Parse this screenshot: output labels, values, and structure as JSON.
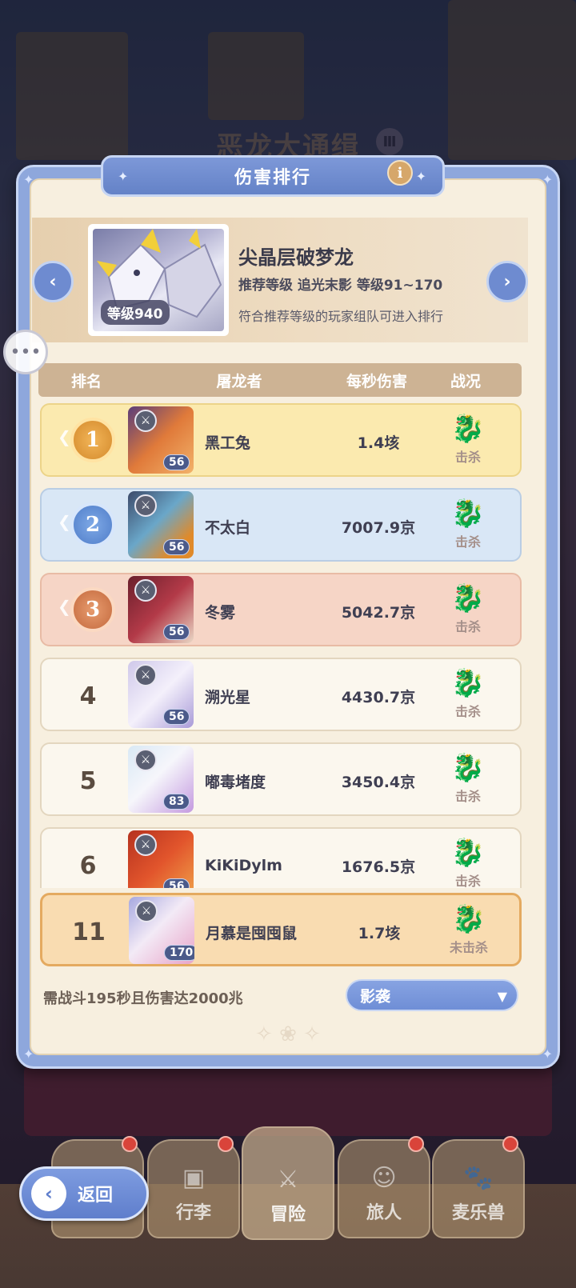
{
  "background": {
    "event_title": "恶龙大通缉",
    "event_badge": "Ⅲ"
  },
  "panel": {
    "title": "伤害排行",
    "info_icon": "i"
  },
  "boss": {
    "name": "尖晶层破梦龙",
    "level_label": "等级940",
    "recommend": "推荐等级 追光末影 等级91~170",
    "hint": "符合推荐等级的玩家组队可进入排行",
    "prev_icon": "chevron-left-icon",
    "next_icon": "chevron-right-icon"
  },
  "table": {
    "headers": {
      "rank": "排名",
      "player": "屠龙者",
      "dps": "每秒伤害",
      "status": "战况"
    },
    "rows": [
      {
        "rank": "1",
        "name": "黑工兔",
        "level": "56",
        "dps": "1.4垓",
        "status": "击杀",
        "style": "gold"
      },
      {
        "rank": "2",
        "name": "不太白",
        "level": "56",
        "dps": "7007.9京",
        "status": "击杀",
        "style": "silver"
      },
      {
        "rank": "3",
        "name": "冬雾",
        "level": "56",
        "dps": "5042.7京",
        "status": "击杀",
        "style": "bronze"
      },
      {
        "rank": "4",
        "name": "溯光星",
        "level": "56",
        "dps": "4430.7京",
        "status": "击杀",
        "style": "plain"
      },
      {
        "rank": "5",
        "name": "嘟毒堵度",
        "level": "83",
        "dps": "3450.4京",
        "status": "击杀",
        "style": "plain"
      },
      {
        "rank": "6",
        "name": "KiKiDylm",
        "level": "56",
        "dps": "1676.5京",
        "status": "击杀",
        "style": "plain"
      }
    ],
    "my_row": {
      "rank": "11",
      "name": "月慕是囤囤鼠",
      "level": "170",
      "dps": "1.7垓",
      "status": "未击杀"
    }
  },
  "footer": {
    "requirement": "需战斗195秒且伤害达2000兆",
    "select_value": "影袭"
  },
  "bottom_nav": {
    "back_label": "返回",
    "tabs": [
      "行李",
      "冒险",
      "旅人",
      "麦乐兽"
    ]
  },
  "colors": {
    "panel_blue": "#8ea7dc",
    "parchment": "#f7efdf",
    "gold_row": "#fbeaaf",
    "silver_row": "#d9e7f6",
    "bronze_row": "#f6d5c6",
    "my_row": "#f9dcb1"
  }
}
